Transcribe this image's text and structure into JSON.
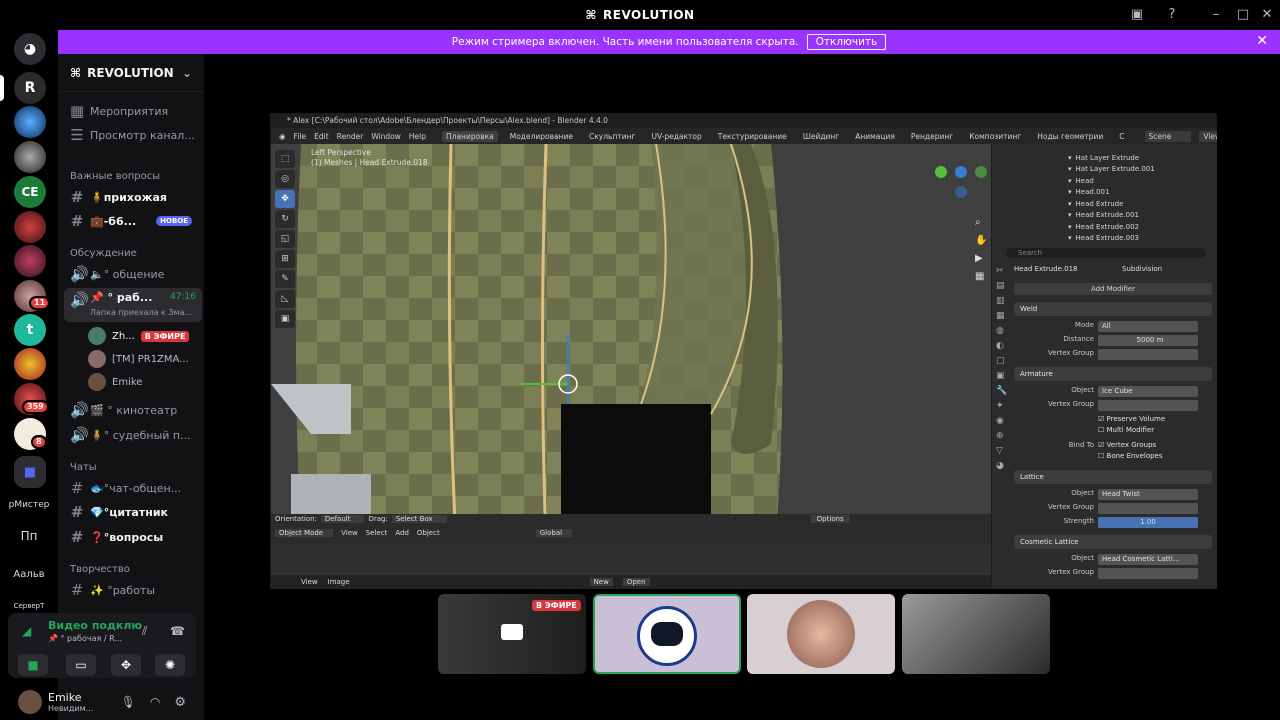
{
  "window": {
    "title": "REVOLUTION"
  },
  "banner": {
    "text": "Режим стримера включен. Часть имени пользователя скрыта.",
    "button": "Отключить"
  },
  "guilds": {
    "badges": [
      "11",
      "359",
      "8"
    ],
    "folders": [
      "рМистер",
      "Пп",
      "Аальв",
      "СерверТ"
    ]
  },
  "server": {
    "name": "REVOLUTION"
  },
  "channels": {
    "events": "Мероприятия",
    "browse": "Просмотр канал...",
    "cat_important": "Важные вопросы",
    "prihozhaya": "🧍прихожая",
    "b6": "💼-б6...",
    "new_badge": "НОВОЕ",
    "cat_discussion": "Обсуждение",
    "obshenie": "🔈° общение",
    "rabochaya": "📌 ° раб...",
    "rabochaya_timer": "47:16",
    "rabochaya_status": "Лапка приехала к Зма...",
    "cat_chats": "Чаты",
    "kinoteatr": "🎬 ° кинотеатр",
    "sudebny": "🧍° судебный п...",
    "chat_general": "🐟°чат-общен...",
    "citatnik": "💎°цитатник",
    "voprosy": "❓°вопросы",
    "cat_creative": "Творчество",
    "raboty": "✨ °работы"
  },
  "voice_users": [
    {
      "name": "Zh...",
      "live": "В ЭФИРЕ"
    },
    {
      "name": "[TM] PR1ZMA..."
    },
    {
      "name": "Emike"
    }
  ],
  "voice_panel": {
    "status": "Видео подклю",
    "channel": "📌 ° рабочая / R..."
  },
  "user_panel": {
    "name": "Emike",
    "status": "Невидим..."
  },
  "blender": {
    "title": "* Alex [C:\\Рабочий стол\\Adobe\\Блендер\\Проекты\\Персы\\Alex.blend] - Blender 4.4.0",
    "menu": [
      "File",
      "Edit",
      "Render",
      "Window",
      "Help"
    ],
    "workspaces": [
      "Планировка",
      "Моделирование",
      "Скульптинг",
      "UV-редактор",
      "Текстурирование",
      "Шейдинг",
      "Анимация",
      "Рендеринг",
      "Композитинг",
      "Ноды геометрии",
      "С"
    ],
    "scene": "Scene",
    "viewlayer": "ViewLayer",
    "viewport_line1": "Left Perspective",
    "viewport_line2": "(1) Meshes | Head Extrude.018",
    "bottom": {
      "orientation_label": "Orientation:",
      "orientation": "Default",
      "drag_label": "Drag:",
      "drag": "Select Box",
      "options": "Options",
      "mode": "Object Mode",
      "view": "View",
      "select": "Select",
      "add": "Add",
      "object": "Object",
      "global": "Global",
      "view2": "View",
      "image": "Image",
      "new": "New",
      "open": "Open"
    },
    "outliner": [
      "Hat Layer Extrude",
      "Hat Layer Extrude.001",
      "Head",
      "Head.001",
      "Head Extrude",
      "Head Extrude.001",
      "Head Extrude.002",
      "Head Extrude.003"
    ],
    "search_placeholder": "Search",
    "props": {
      "object": "Head Extrude.018",
      "modifier": "Subdivision",
      "add_modifier": "Add Modifier",
      "weld": "Weld",
      "mode_label": "Mode",
      "mode": "All",
      "distance_label": "Distance",
      "distance": "5000 m",
      "vgroup_label": "Vertex Group",
      "armature": "Armature",
      "object_label": "Object",
      "arm_object": "Ice Cube",
      "preserve_volume": "Preserve Volume",
      "multi_modifier": "Multi Modifier",
      "bind_to": "Bind To",
      "vertex_groups": "Vertex Groups",
      "bone_envelopes": "Bone Envelopes",
      "lattice": "Lattice",
      "lat_object": "Head Twist",
      "strength_label": "Strength",
      "strength": "1.00",
      "cosmetic_lattice": "Cosmetic Lattice",
      "cos_object": "Head Cosmetic Latti..."
    }
  },
  "stream_tiles": {
    "live": "В ЭФИРЕ"
  },
  "colors": {
    "accent": "#9b33ff",
    "live": "#da373c",
    "speaking": "#23a55a",
    "selected_tile": "#c9bfd6"
  }
}
